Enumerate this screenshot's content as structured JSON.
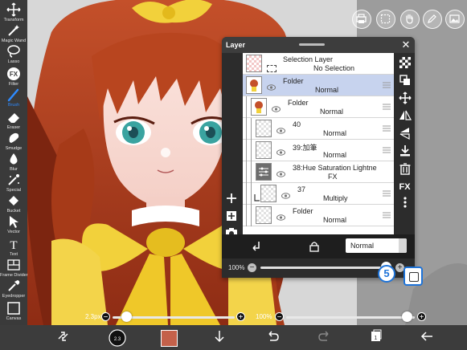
{
  "colors": {
    "accent": "#2e8bff",
    "panel_bg": "#2c2c2c",
    "selected_row": "#c7d3ee",
    "primary_color_swatch": "#c4614a",
    "tutorial_marker": "#1e73d8"
  },
  "left_toolbar": {
    "tools": [
      {
        "label": "Transform",
        "icon": "move-arrows-icon"
      },
      {
        "label": "Magic Wand",
        "icon": "magic-wand-icon"
      },
      {
        "label": "Lasso",
        "icon": "lasso-icon"
      },
      {
        "label": "Filter",
        "icon": "fx-icon"
      },
      {
        "label": "Brush",
        "icon": "brush-icon",
        "active": true
      },
      {
        "label": "Eraser",
        "icon": "eraser-icon"
      },
      {
        "label": "Smudge",
        "icon": "smudge-icon"
      },
      {
        "label": "Blur",
        "icon": "blur-drop-icon"
      },
      {
        "label": "Special",
        "icon": "special-wand-icon"
      },
      {
        "label": "Bucket",
        "icon": "bucket-icon"
      },
      {
        "label": "Vector",
        "icon": "vector-arrow-icon"
      },
      {
        "label": "Text",
        "icon": "text-icon"
      },
      {
        "label": "Frame Divider",
        "icon": "frame-divider-icon"
      },
      {
        "label": "Eyedropper",
        "icon": "eyedropper-icon"
      },
      {
        "label": "Canvas",
        "icon": "canvas-icon"
      }
    ]
  },
  "top_buttons": [
    "print-icon",
    "selection-icon",
    "hand-icon",
    "pen-icon",
    "image-icon"
  ],
  "layer_panel": {
    "title": "Layer",
    "close": "✕",
    "layers": [
      {
        "name": "Selection Layer",
        "mode": "No Selection",
        "kind": "selection"
      },
      {
        "name": "Folder",
        "mode": "Normal",
        "kind": "folder",
        "selected": true
      },
      {
        "name": "Folder",
        "mode": "Normal",
        "kind": "folder"
      },
      {
        "name": "40",
        "mode": "Normal",
        "kind": "layer"
      },
      {
        "name": "39:加筆",
        "mode": "Normal",
        "kind": "layer"
      },
      {
        "name": "38:Hue Saturation Lightne",
        "mode": "FX",
        "kind": "fx"
      },
      {
        "name": "37",
        "mode": "Multiply",
        "kind": "layer"
      },
      {
        "name": "Folder",
        "mode": "Normal",
        "kind": "folder"
      }
    ],
    "blend_mode": "Normal",
    "opacity": "100%"
  },
  "bottom_sliders": {
    "brush_size": "2.3px",
    "brush_opacity": "100%"
  },
  "tutorial_step": "5"
}
